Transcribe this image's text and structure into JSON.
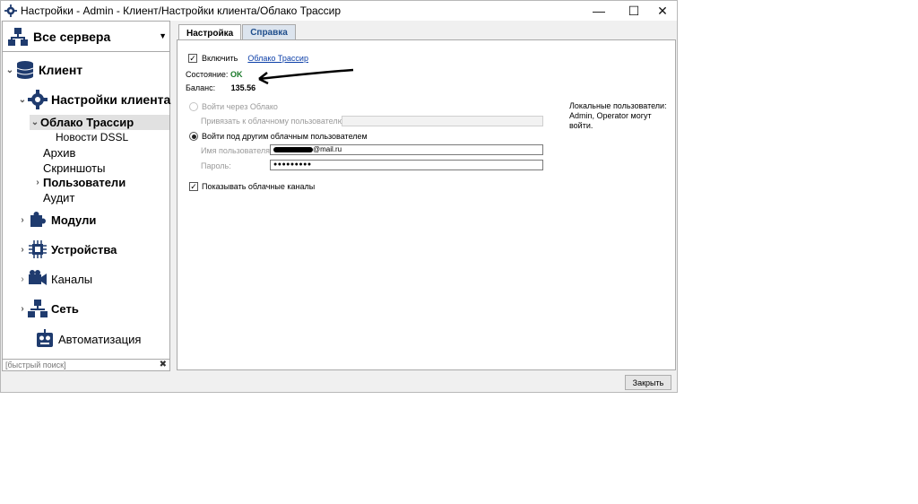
{
  "window": {
    "title": "Настройки - Admin - Клиент/Настройки клиента/Облако Трассир"
  },
  "sidebar": {
    "server_selector": "Все сервера",
    "tree": {
      "client": "Клиент",
      "client_settings": "Настройки клиента",
      "cloud": "Облако Трассир",
      "news": "Новости DSSL",
      "archive": "Архив",
      "screenshots": "Скриншоты",
      "users": "Пользователи",
      "audit": "Аудит",
      "modules": "Модули",
      "devices": "Устройства",
      "channels": "Каналы",
      "network": "Сеть",
      "automation": "Автоматизация"
    },
    "quick_search_placeholder": "[быстрый поиск]"
  },
  "tabs": {
    "settings": "Настройка",
    "help": "Справка"
  },
  "panel": {
    "enable_label": "Включить",
    "cloud_link": "Облако Трассир",
    "status_label": "Состояние:",
    "status_value": "OK",
    "balance_label": "Баланс:",
    "balance_value": "135.56",
    "login_via_cloud": "Войти через Облако",
    "bind_label": "Привязать к облачному пользователю:",
    "login_other": "Войти под другим облачным пользователем",
    "username_label": "Имя пользователя:",
    "username_value": "@mail.ru",
    "password_label": "Пароль:",
    "password_value": "●●●●●●●●●",
    "show_channels": "Показывать облачные каналы",
    "local_users_note": "Локальные пользователи: Admin, Operator могут войти."
  },
  "footer": {
    "close_button": "Закрыть"
  },
  "colors": {
    "status_ok": "#1a7a2a",
    "link": "#0b3ea8",
    "tree_icon": "#1f3b6e"
  }
}
